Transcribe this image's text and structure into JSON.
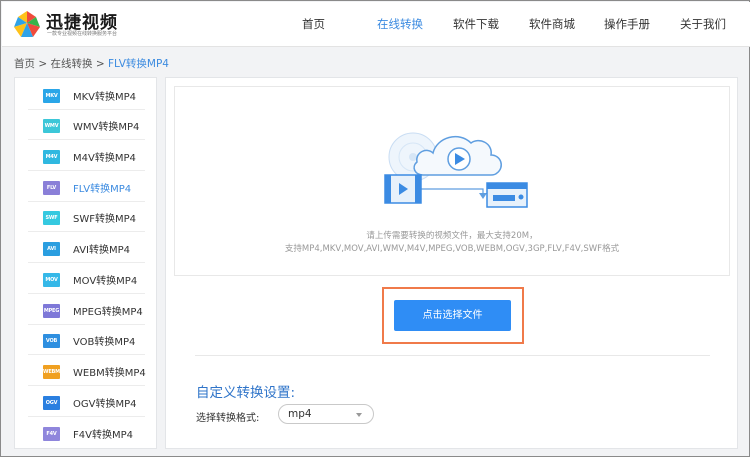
{
  "brand": {
    "name": "迅捷视频",
    "slogan": "一款专业视频在线转换服务平台"
  },
  "nav": [
    {
      "label": "首页",
      "active": false
    },
    {
      "label": "在线转换",
      "active": true
    },
    {
      "label": "软件下载",
      "active": false
    },
    {
      "label": "软件商城",
      "active": false
    },
    {
      "label": "操作手册",
      "active": false
    },
    {
      "label": "关于我们",
      "active": false
    }
  ],
  "breadcrumb": {
    "items": [
      "首页",
      "在线转换",
      "FLV转换MP4"
    ],
    "separator": ">"
  },
  "sidebar": {
    "items": [
      {
        "badge": "MKV",
        "label": "MKV转换MP4",
        "color": "#2aa6e8",
        "active": false
      },
      {
        "badge": "WMV",
        "label": "WMV转换MP4",
        "color": "#3cc7d8",
        "active": false
      },
      {
        "badge": "M4V",
        "label": "M4V转换MP4",
        "color": "#2fb8e0",
        "active": false
      },
      {
        "badge": "FLV",
        "label": "FLV转换MP4",
        "color": "#8a7fd8",
        "active": true
      },
      {
        "badge": "SWF",
        "label": "SWF转换MP4",
        "color": "#35c9e0",
        "active": false
      },
      {
        "badge": "AVI",
        "label": "AVI转换MP4",
        "color": "#2a9ee0",
        "active": false
      },
      {
        "badge": "MOV",
        "label": "MOV转换MP4",
        "color": "#35b8e8",
        "active": false
      },
      {
        "badge": "MPEG",
        "label": "MPEG转换MP4",
        "color": "#7e78d8",
        "active": false
      },
      {
        "badge": "VOB",
        "label": "VOB转换MP4",
        "color": "#2e8fe0",
        "active": false
      },
      {
        "badge": "WEBM",
        "label": "WEBM转换MP4",
        "color": "#f0a020",
        "active": false
      },
      {
        "badge": "OGV",
        "label": "OGV转换MP4",
        "color": "#2a7fe0",
        "active": false
      },
      {
        "badge": "F4V",
        "label": "F4V转换MP4",
        "color": "#8f86dc",
        "active": false
      }
    ]
  },
  "upload": {
    "hint_line1": "请上传需要转换的视频文件，最大支持20M，",
    "hint_line2": "支持MP4,MKV,MOV,AVI,WMV,M4V,MPEG,VOB,WEBM,OGV,3GP,FLV,F4V,SWF格式",
    "button_label": "点击选择文件"
  },
  "settings": {
    "title": "自定义转换设置:",
    "format_label": "选择转换格式:",
    "format_value": "mp4"
  },
  "colors": {
    "accent": "#3c8be0",
    "button": "#2f8df5",
    "highlight": "#f07a4a",
    "settings_title": "#2f74c9"
  }
}
